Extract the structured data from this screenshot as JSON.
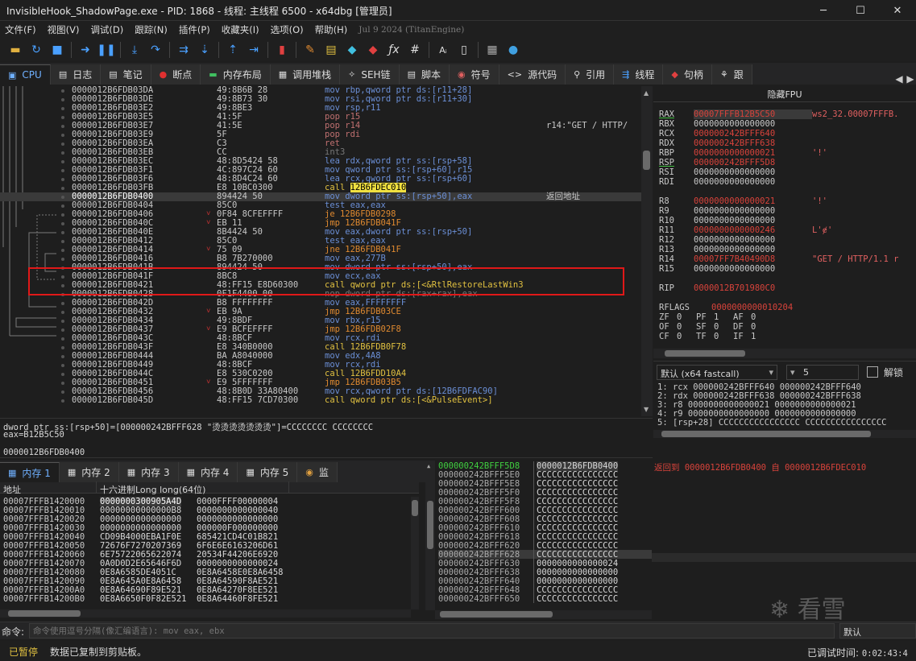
{
  "window": {
    "title": "InvisibleHook_ShadowPage.exe - PID: 1868 - 线程: 主线程 6500 - x64dbg [管理员]",
    "controls": [
      "─",
      "☐",
      "✕"
    ]
  },
  "menu": {
    "items": [
      "文件(F)",
      "视图(V)",
      "调试(D)",
      "跟踪(N)",
      "插件(P)",
      "收藏夹(I)",
      "选项(O)",
      "帮助(H)"
    ],
    "version": "Jul 9 2024 (TitanEngine)"
  },
  "toolbar": {
    "icons": [
      "open-icon",
      "restart-icon",
      "stop-icon",
      "run-icon",
      "pause-icon",
      "step-into-icon",
      "step-over-icon",
      "trace-into-icon",
      "trace-over-icon",
      "execute-till-return-icon",
      "run-to-user-code-icon",
      "patch-icon",
      "highlighter-icon",
      "comment-icon",
      "bookmark-icon",
      "label-icon",
      "function-icon",
      "hash-icon",
      "font-icon",
      "device-icon",
      "calculator-icon",
      "globe-icon"
    ]
  },
  "tabs": [
    {
      "label": "CPU",
      "icon": "cpu-icon",
      "active": true
    },
    {
      "label": "日志",
      "icon": "log-icon"
    },
    {
      "label": "笔记",
      "icon": "notes-icon"
    },
    {
      "label": "断点",
      "icon": "breakpoint-icon"
    },
    {
      "label": "内存布局",
      "icon": "memory-map-icon"
    },
    {
      "label": "调用堆栈",
      "icon": "call-stack-icon"
    },
    {
      "label": "SEH链",
      "icon": "seh-icon"
    },
    {
      "label": "脚本",
      "icon": "script-icon"
    },
    {
      "label": "符号",
      "icon": "symbols-icon"
    },
    {
      "label": "源代码",
      "icon": "source-icon"
    },
    {
      "label": "引用",
      "icon": "references-icon"
    },
    {
      "label": "线程",
      "icon": "threads-icon"
    },
    {
      "label": "句柄",
      "icon": "handles-icon"
    },
    {
      "label": "跟",
      "icon": "trace-icon"
    }
  ],
  "disasm": [
    {
      "addr": "0000012B6FDB03DA",
      "bytes": "49:8B6B 28",
      "mnem": "mov rbp,qword ptr ds:[r11+28]",
      "k": "mov",
      "comment": ""
    },
    {
      "addr": "0000012B6FDB03DE",
      "bytes": "49:8B73 30",
      "mnem": "mov rsi,qword ptr ds:[r11+30]",
      "k": "mov",
      "comment": ""
    },
    {
      "addr": "0000012B6FDB03E2",
      "bytes": "49:8BE3",
      "mnem": "mov rsp,r11",
      "k": "mov",
      "comment": ""
    },
    {
      "addr": "0000012B6FDB03E5",
      "bytes": "41:5F",
      "mnem": "pop r15",
      "k": "pop",
      "comment": ""
    },
    {
      "addr": "0000012B6FDB03E7",
      "bytes": "41:5E",
      "mnem": "pop r14",
      "k": "pop",
      "comment": "r14:\"GET / HTTP/"
    },
    {
      "addr": "0000012B6FDB03E9",
      "bytes": "5F",
      "mnem": "pop rdi",
      "k": "pop",
      "comment": ""
    },
    {
      "addr": "0000012B6FDB03EA",
      "bytes": "C3",
      "mnem": "ret",
      "k": "ret",
      "comment": ""
    },
    {
      "addr": "0000012B6FDB03EB",
      "bytes": "CC",
      "mnem": "int3",
      "k": "gray",
      "comment": ""
    },
    {
      "addr": "0000012B6FDB03EC",
      "bytes": "48:8D5424 58",
      "mnem": "lea rdx,qword ptr ss:[rsp+58]",
      "k": "mov",
      "comment": ""
    },
    {
      "addr": "0000012B6FDB03F1",
      "bytes": "4C:897C24 60",
      "mnem": "mov qword ptr ss:[rsp+60],r15",
      "k": "mov",
      "comment": ""
    },
    {
      "addr": "0000012B6FDB03F6",
      "bytes": "48:8D4C24 60",
      "mnem": "lea rcx,qword ptr ss:[rsp+60]",
      "k": "mov",
      "comment": ""
    },
    {
      "addr": "0000012B6FDB03FB",
      "bytes": "E8 10BC0300",
      "mnem": "call 12B6FDEC010",
      "k": "callhl",
      "comment": ""
    },
    {
      "addr": "0000012B6FDB0400",
      "bytes": "894424 50",
      "mnem": "mov dword ptr ss:[rsp+50],eax",
      "k": "mov",
      "comment": "返回地址",
      "sel": true
    },
    {
      "addr": "0000012B6FDB0404",
      "bytes": "85C0",
      "mnem": "test eax,eax",
      "k": "mov",
      "comment": ""
    },
    {
      "addr": "0000012B6FDB0406",
      "bytes": "0F84 8CFEFFFF",
      "mnem": "je 12B6FDB0298",
      "k": "jmp",
      "comment": ""
    },
    {
      "addr": "0000012B6FDB040C",
      "bytes": "EB 11",
      "mnem": "jmp 12B6FDB041F",
      "k": "jmp",
      "comment": ""
    },
    {
      "addr": "0000012B6FDB040E",
      "bytes": "8B4424 50",
      "mnem": "mov eax,dword ptr ss:[rsp+50]",
      "k": "mov",
      "comment": ""
    },
    {
      "addr": "0000012B6FDB0412",
      "bytes": "85C0",
      "mnem": "test eax,eax",
      "k": "mov",
      "comment": ""
    },
    {
      "addr": "0000012B6FDB0414",
      "bytes": "75 09",
      "mnem": "jne 12B6FDB041F",
      "k": "jmp",
      "comment": ""
    },
    {
      "addr": "0000012B6FDB0416",
      "bytes": "B8 7B270000",
      "mnem": "mov eax,277B",
      "k": "mov",
      "comment": ""
    },
    {
      "addr": "0000012B6FDB041B",
      "bytes": "894424 50",
      "mnem": "mov dword ptr ss:[rsp+50],eax",
      "k": "mov",
      "comment": ""
    },
    {
      "addr": "0000012B6FDB041F",
      "bytes": "8BC8",
      "mnem": "mov ecx,eax",
      "k": "mov",
      "comment": ""
    },
    {
      "addr": "0000012B6FDB0421",
      "bytes": "48:FF15 E8D60300",
      "mnem": "call qword ptr ds:[<&RtlRestoreLastWin3",
      "k": "call",
      "comment": ""
    },
    {
      "addr": "0000012B6FDB0428",
      "bytes": "0F1F4400 00",
      "mnem": "nop dword ptr ds:[rax+rax],eax",
      "k": "gray",
      "comment": ""
    },
    {
      "addr": "0000012B6FDB042D",
      "bytes": "B8 FFFFFFFF",
      "mnem": "mov eax,FFFFFFFF",
      "k": "mov",
      "comment": ""
    },
    {
      "addr": "0000012B6FDB0432",
      "bytes": "EB 9A",
      "mnem": "jmp 12B6FDB03CE",
      "k": "jmp",
      "comment": ""
    },
    {
      "addr": "0000012B6FDB0434",
      "bytes": "49:8BDF",
      "mnem": "mov rbx,r15",
      "k": "mov",
      "comment": ""
    },
    {
      "addr": "0000012B6FDB0437",
      "bytes": "E9 BCFEFFFF",
      "mnem": "jmp 12B6FDB02F8",
      "k": "jmp",
      "comment": ""
    },
    {
      "addr": "0000012B6FDB043C",
      "bytes": "48:8BCF",
      "mnem": "mov rcx,rdi",
      "k": "mov",
      "comment": ""
    },
    {
      "addr": "0000012B6FDB043F",
      "bytes": "E8 340B0000",
      "mnem": "call 12B6FDB0F78",
      "k": "call",
      "comment": ""
    },
    {
      "addr": "0000012B6FDB0444",
      "bytes": "BA A8040000",
      "mnem": "mov edx,4A8",
      "k": "mov",
      "comment": ""
    },
    {
      "addr": "0000012B6FDB0449",
      "bytes": "48:8BCF",
      "mnem": "mov rcx,rdi",
      "k": "mov",
      "comment": ""
    },
    {
      "addr": "0000012B6FDB044C",
      "bytes": "E8 530C0200",
      "mnem": "call 12B6FDD10A4",
      "k": "call",
      "comment": ""
    },
    {
      "addr": "0000012B6FDB0451",
      "bytes": "E9 5FFFFFFF",
      "mnem": "jmp 12B6FDB03B5",
      "k": "jmp",
      "comment": ""
    },
    {
      "addr": "0000012B6FDB0456",
      "bytes": "48:8B0D 33A80400",
      "mnem": "mov rcx,qword ptr ds:[12B6FDFAC90]",
      "k": "mov",
      "comment": ""
    },
    {
      "addr": "0000012B6FDB045D",
      "bytes": "48:FF15 7CD70300",
      "mnem": "call qword ptr ds:[<&PulseEvent>]",
      "k": "call",
      "comment": ""
    }
  ],
  "registers": {
    "header": "隐藏FPU",
    "list": [
      {
        "name": "RAX",
        "value": "00007FFFB12B5C50",
        "comment": "ws2_32.00007FFFB."
      },
      {
        "name": "RBX",
        "value": "0000000000000000",
        "comment": ""
      },
      {
        "name": "RCX",
        "value": "000000242BFFF640",
        "comment": ""
      },
      {
        "name": "RDX",
        "value": "000000242BFFF638",
        "comment": ""
      },
      {
        "name": "RBP",
        "value": "0000000000000021",
        "comment": "'!'"
      },
      {
        "name": "RSP",
        "value": "000000242BFFF5D8",
        "comment": ""
      },
      {
        "name": "RSI",
        "value": "0000000000000000",
        "comment": ""
      },
      {
        "name": "RDI",
        "value": "0000000000000000",
        "comment": ""
      },
      {
        "name": "R8",
        "value": "0000000000000021",
        "comment": "'!'"
      },
      {
        "name": "R9",
        "value": "0000000000000000",
        "comment": ""
      },
      {
        "name": "R10",
        "value": "0000000000000000",
        "comment": ""
      },
      {
        "name": "R11",
        "value": "0000000000000246",
        "comment": "L'ɇ'"
      },
      {
        "name": "R12",
        "value": "0000000000000000",
        "comment": ""
      },
      {
        "name": "R13",
        "value": "0000000000000000",
        "comment": ""
      },
      {
        "name": "R14",
        "value": "00007FF7B40490D8",
        "comment": "\"GET / HTTP/1.1 r"
      },
      {
        "name": "R15",
        "value": "0000000000000000",
        "comment": ""
      },
      {
        "name": "RIP",
        "value": "0000012B701980C0",
        "comment": ""
      }
    ],
    "rflags_label": "RFLAGS",
    "rflags": "0000000000010204",
    "flags": [
      [
        "ZF",
        "0",
        "PF",
        "1",
        "AF",
        "0"
      ],
      [
        "OF",
        "0",
        "SF",
        "0",
        "DF",
        "0"
      ],
      [
        "CF",
        "0",
        "TF",
        "0",
        "IF",
        "1"
      ]
    ]
  },
  "callconv": {
    "selected": "默认 (x64 fastcall)",
    "argcount": "5",
    "unlock_label": "解锁"
  },
  "stackargs": [
    "1: rcx 000000242BFFF640 000000242BFFF640",
    "2: rdx 000000242BFFF638 000000242BFFF638",
    "3: r8 0000000000000021 0000000000000021",
    "4: r9 0000000000000000 0000000000000000",
    "5: [rsp+28] CCCCCCCCCCCCCCCC CCCCCCCCCCCCCCCC"
  ],
  "info": {
    "line1": "dword ptr ss:[rsp+50]=[000000242BFFF628 \"烫烫烫烫烫烫烫\"]=CCCCCCCC CCCCCCCC",
    "line2": "eax=B12B5C50",
    "addr": "0000012B6FDB0400"
  },
  "dumptabs": [
    "内存 1",
    "内存 2",
    "内存 3",
    "内存 4",
    "内存 5",
    "监"
  ],
  "dump": {
    "col_addr": "地址",
    "col_hex": "十六进制Long long(64位)",
    "rows": [
      [
        "00007FFFB1420000",
        "0000000300905A4D",
        "0000FFFF00000004"
      ],
      [
        "00007FFFB1420010",
        "00000000000000B8",
        "0000000000000040"
      ],
      [
        "00007FFFB1420020",
        "0000000000000000",
        "0000000000000000"
      ],
      [
        "00007FFFB1420030",
        "0000000000000000",
        "000000F000000000"
      ],
      [
        "00007FFFB1420040",
        "CD09B4000EBA1F0E",
        "685421CD4C01B821"
      ],
      [
        "00007FFFB1420050",
        "72676F7270207369",
        "6F6E6E6163206D61"
      ],
      [
        "00007FFFB1420060",
        "6E75722065622074",
        "20534F44206E6920"
      ],
      [
        "00007FFFB1420070",
        "0A0D0D2E65646F6D",
        "0000000000000024"
      ],
      [
        "00007FFFB1420080",
        "0E8A6585DE4051C",
        "0E8A6458E0E8A6458"
      ],
      [
        "00007FFFB1420090",
        "0E8A645A0E8A6458",
        "0E8A64590F8AE521"
      ],
      [
        "00007FFFB14200A0",
        "0E8A64690F89E521",
        "0E8A64270F8EE521"
      ],
      [
        "00007FFFB14200B0",
        "0E8A6650F0F82E521",
        "0E8A64460F8FE521"
      ]
    ]
  },
  "stack": {
    "rows": [
      [
        "000000242BFFF5D8",
        "0000012B6FDB0400"
      ],
      [
        "000000242BFFF5E0",
        "CCCCCCCCCCCCCCCC"
      ],
      [
        "000000242BFFF5E8",
        "CCCCCCCCCCCCCCCC"
      ],
      [
        "000000242BFFF5F0",
        "CCCCCCCCCCCCCCCC"
      ],
      [
        "000000242BFFF5F8",
        "CCCCCCCCCCCCCCCC"
      ],
      [
        "000000242BFFF600",
        "CCCCCCCCCCCCCCCC"
      ],
      [
        "000000242BFFF608",
        "CCCCCCCCCCCCCCCC"
      ],
      [
        "000000242BFFF610",
        "CCCCCCCCCCCCCCCC"
      ],
      [
        "000000242BFFF618",
        "CCCCCCCCCCCCCCCC"
      ],
      [
        "000000242BFFF620",
        "CCCCCCCCCCCCCCCC"
      ],
      [
        "000000242BFFF628",
        "CCCCCCCCCCCCCCCC"
      ],
      [
        "000000242BFFF630",
        "0000000000000024"
      ],
      [
        "000000242BFFF638",
        "0000000000000000"
      ],
      [
        "000000242BFFF640",
        "0000000000000000"
      ],
      [
        "000000242BFFF648",
        "CCCCCCCCCCCCCCCC"
      ],
      [
        "000000242BFFF650",
        "CCCCCCCCCCCCCCCC"
      ]
    ],
    "comment": "返回到 0000012B6FDB0400 自 0000012B6FDEC010"
  },
  "cmd": {
    "label": "命令:",
    "placeholder": "命令使用逗号分隔(像汇编语言): mov eax, ebx",
    "right": "默认"
  },
  "status": {
    "state": "已暂停",
    "message": "数据已复制到剪贴板。",
    "time_label": "已调试时间:",
    "time": "0:02:43:4"
  },
  "watermark": "看雪"
}
